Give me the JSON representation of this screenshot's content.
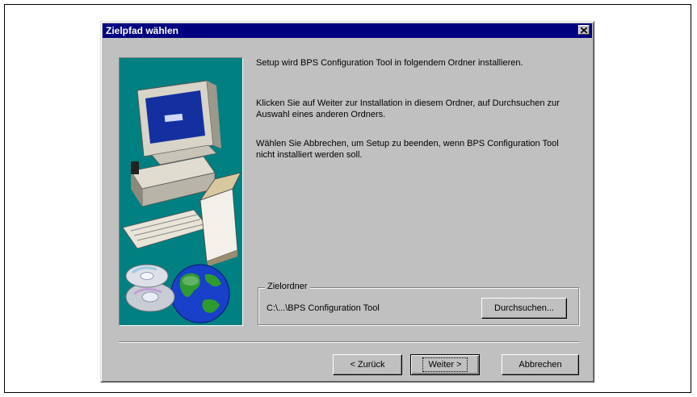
{
  "dialog": {
    "title": "Zielpfad wählen",
    "close_label": "×"
  },
  "messages": {
    "line1": "Setup wird BPS Configuration Tool in folgendem Ordner installieren.",
    "line2": "Klicken Sie auf Weiter zur Installation in diesem Ordner, auf Durchsuchen zur Auswahl eines anderen Ordners.",
    "line3": "Wählen Sie Abbrechen, um Setup zu beenden, wenn BPS Configuration Tool nicht installiert werden soll."
  },
  "destination": {
    "group_label": "Zielordner",
    "path": "C:\\...\\BPS Configuration Tool",
    "browse_label": "Durchsuchen..."
  },
  "buttons": {
    "back_label": "< Zurück",
    "next_label": "Weiter >",
    "cancel_label": "Abbrechen"
  },
  "colors": {
    "titlebar": "#000080",
    "dialog_bg": "#c0c0c0",
    "illustration_bg": "#008080"
  },
  "icons": {
    "illustration": [
      "computer-icon",
      "globe-icon",
      "cd-icon"
    ]
  }
}
